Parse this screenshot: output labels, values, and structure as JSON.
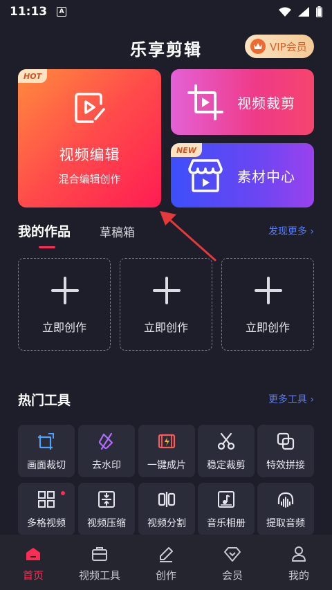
{
  "status_bar": {
    "time": "11:13",
    "notification_badge": "A"
  },
  "header": {
    "title": "乐享剪辑",
    "vip_label": "VIP会员"
  },
  "cards": {
    "main": {
      "tag": "HOT",
      "title": "视频编辑",
      "subtitle": "混合编辑创作"
    },
    "crop": {
      "label": "视频裁剪"
    },
    "material": {
      "tag": "NEW",
      "label": "素材中心"
    }
  },
  "works": {
    "tabs": [
      "我的作品",
      "草稿箱"
    ],
    "discover_more": "发现更多 ›",
    "create_label": "立即创作"
  },
  "hot_tools": {
    "title": "热门工具",
    "more": "更多工具 ›",
    "items": [
      {
        "label": "画面裁切",
        "icon": "crop-icon"
      },
      {
        "label": "去水印",
        "icon": "eraser-icon"
      },
      {
        "label": "一键成片",
        "icon": "film-flash-icon"
      },
      {
        "label": "稳定裁剪",
        "icon": "scissors-icon"
      },
      {
        "label": "特效拼接",
        "icon": "overlap-squares-icon"
      },
      {
        "label": "多格视频",
        "icon": "grid-icon"
      },
      {
        "label": "视频压缩",
        "icon": "compress-icon"
      },
      {
        "label": "视频分割",
        "icon": "split-icon"
      },
      {
        "label": "音乐相册",
        "icon": "music-album-icon"
      },
      {
        "label": "提取音频",
        "icon": "waveform-icon"
      }
    ]
  },
  "bottom_nav": {
    "items": [
      {
        "label": "首页",
        "icon": "home-icon",
        "active": true
      },
      {
        "label": "视频工具",
        "icon": "toolbox-icon"
      },
      {
        "label": "创作",
        "icon": "pen-icon"
      },
      {
        "label": "会员",
        "icon": "diamond-icon"
      },
      {
        "label": "我的",
        "icon": "user-icon"
      }
    ]
  },
  "colors": {
    "background": "#1d1e29",
    "accent_red": "#ff2d55",
    "link_blue": "#5b7cf2",
    "tool_bg": "#2b2c39",
    "nav_bg": "#24252f"
  }
}
